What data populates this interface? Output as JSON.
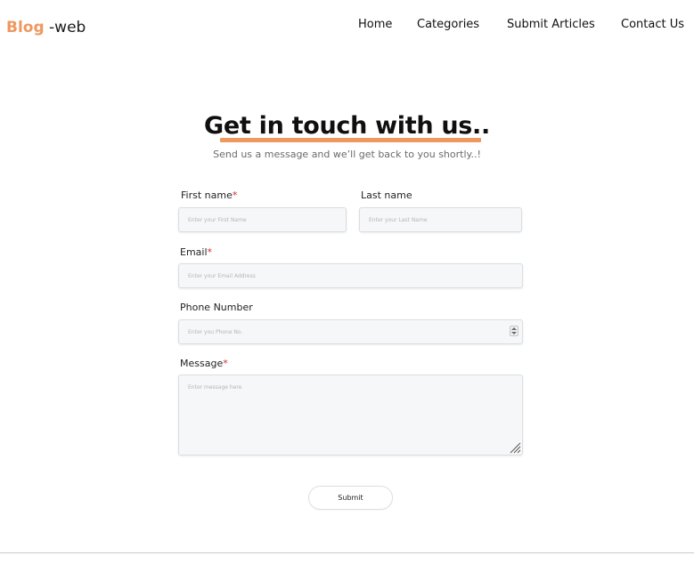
{
  "header": {
    "logo_brand": "Blog",
    "logo_rest": " -web",
    "nav": {
      "home": "Home",
      "categories": "Categories",
      "submit_articles": "Submit Articles",
      "contact_us": "Contact Us"
    }
  },
  "contact": {
    "title": "Get in touch with us..",
    "subtitle": "Send us a message and we’ll get back to you shortly..!",
    "required_mark": "*",
    "first_name": {
      "label": "First name",
      "placeholder": "Enter your First Name",
      "value": ""
    },
    "last_name": {
      "label": "Last name",
      "placeholder": "Enter your Last Name",
      "value": ""
    },
    "email": {
      "label": "Email",
      "placeholder": "Enter your Email Address",
      "value": ""
    },
    "phone": {
      "label": "Phone Number",
      "placeholder": "Enter you Phone No.",
      "value": ""
    },
    "message": {
      "label": "Message",
      "placeholder": "Enter message here",
      "value": ""
    },
    "submit_label": "Submit"
  },
  "colors": {
    "accent": "#ee9860",
    "required": "#d62b2b",
    "field_bg": "#f6f7f9"
  },
  "icons": {
    "number_spinner": "spinner-arrows-icon",
    "textarea_resize": "resize-grip-icon"
  }
}
